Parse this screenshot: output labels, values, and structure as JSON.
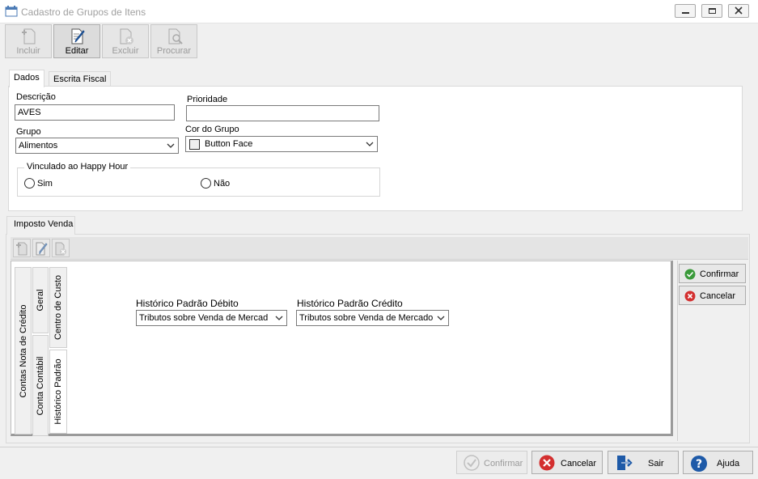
{
  "window": {
    "title": "Cadastro de Grupos de Itens"
  },
  "toolbar": {
    "incluir": "Incluir",
    "editar": "Editar",
    "excluir": "Excluir",
    "procurar": "Procurar"
  },
  "tabs": {
    "dados": "Dados",
    "escrita_fiscal": "Escrita Fiscal"
  },
  "form": {
    "descricao_label": "Descrição",
    "descricao_value": "AVES",
    "prioridade_label": "Prioridade",
    "prioridade_value": "",
    "grupo_label": "Grupo",
    "grupo_value": "Alimentos",
    "cor_label": "Cor do Grupo",
    "cor_value": "Button Face",
    "happy_hour_label": "Vinculado ao Happy Hour",
    "sim": "Sim",
    "nao": "Não"
  },
  "imposto": {
    "tab": "Imposto Venda",
    "vtabs": {
      "contas_nota_credito": "Contas Nota de Crédito",
      "geral": "Geral",
      "conta_contabil": "Conta Contábil",
      "centro_custo": "Centro de Custo",
      "historico_padrao": "Histórico Padrão"
    },
    "debito_label": "Histórico Padrão Débito",
    "debito_value": "Tributos sobre Venda de Mercad",
    "credito_label": "Histórico Padrão Crédito",
    "credito_value": "Tributos sobre Venda de Mercado"
  },
  "side_buttons": {
    "confirmar": "Confirmar",
    "cancelar": "Cancelar"
  },
  "bottom_buttons": {
    "confirmar": "Confirmar",
    "cancelar": "Cancelar",
    "sair": "Sair",
    "ajuda": "Ajuda"
  },
  "colors": {
    "green": "#3a9a3a",
    "red": "#d32f2f",
    "blue": "#1e5aa8",
    "chrome": "#f0f0f0"
  }
}
